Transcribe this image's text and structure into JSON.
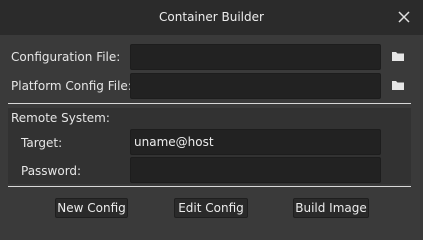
{
  "window": {
    "title": "Container Builder"
  },
  "icons": {
    "close": "close-icon",
    "folder": "folder-icon"
  },
  "form": {
    "config_label": "Configuration File:",
    "config_value": "",
    "platform_label": "Platform Config File:",
    "platform_value": ""
  },
  "remote": {
    "title": "Remote System:",
    "target_label": "Target:",
    "target_value": "uname@host",
    "password_label": "Password:",
    "password_value": ""
  },
  "buttons": {
    "new": "New Config",
    "edit": "Edit Config",
    "build": "Build Image"
  },
  "colors": {
    "background": "#3a3a3a",
    "titlebar": "#2b2b2b",
    "field": "#222222",
    "text": "#e8e8e8"
  }
}
